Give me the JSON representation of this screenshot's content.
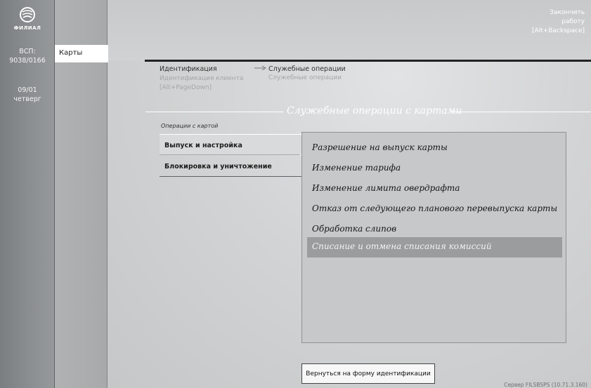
{
  "rail": {
    "logo_text": "ФИЛИАЛ",
    "vsp_label": "ВСП:",
    "vsp_value": "9038/0166",
    "date": "09/01",
    "weekday": "четверг"
  },
  "nav": {
    "cards_label": "Карты"
  },
  "header": {
    "logout_line1": "Закончить",
    "logout_line2": "работу",
    "logout_line3": "[Alt+Backspace]"
  },
  "breadcrumb": {
    "ident": "Идентификация",
    "ident_sub1": "Идентификация клиента",
    "ident_sub2": "[Alt+PageDown]",
    "service": "Служебные операции",
    "service_sub": "Служебные операции"
  },
  "section": {
    "title": "Служебные операции с картами"
  },
  "ops": {
    "caption": "Операции с картой",
    "tabs": [
      {
        "label": "Выпуск и настройка"
      },
      {
        "label": "Блокировка и уничтожение"
      }
    ]
  },
  "panel": {
    "items": [
      {
        "label": "Разрешение на выпуск карты"
      },
      {
        "label": "Изменение тарифа"
      },
      {
        "label": "Изменение лимита овердрафта"
      },
      {
        "label": "Отказ от следующего планового перевыпуска карты"
      },
      {
        "label": "Обработка слипов"
      },
      {
        "label": "Списание и отмена списания комиссий"
      }
    ]
  },
  "footer": {
    "back_label": "Вернуться на форму идентификации",
    "server": "Сервер FILSBSPS (10.71.3.160)"
  },
  "colors": {
    "rail": "#8d9092",
    "navcol": "#b0b2b3",
    "panel": "#c7c8c9",
    "selected_item": "#9a9c9e",
    "top_rule": "#222222"
  }
}
